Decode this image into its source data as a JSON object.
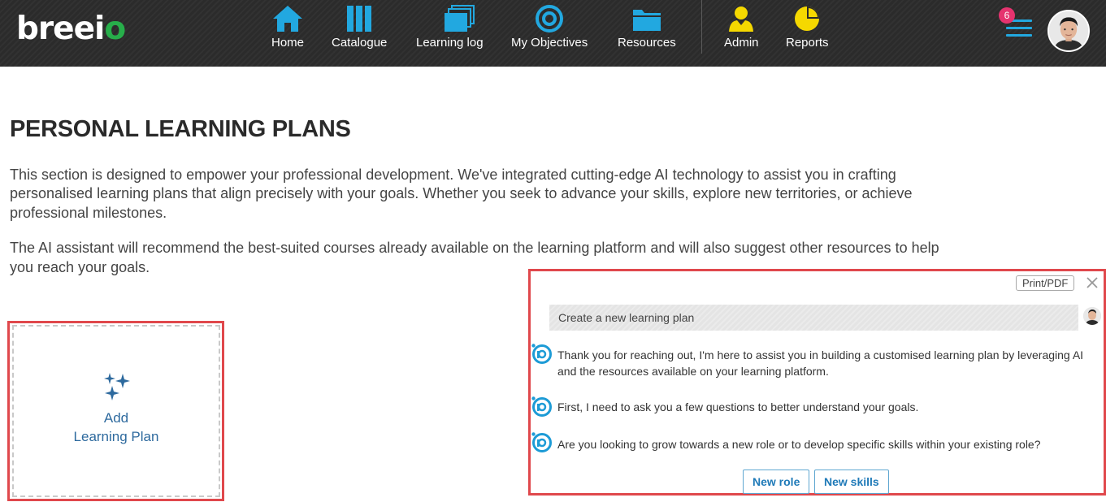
{
  "brand": {
    "logo_text": "breeio",
    "logo_color": "#ffffff",
    "logo_accent": "#27ae4a"
  },
  "nav": {
    "items": [
      {
        "label": "Home",
        "icon": "home-icon"
      },
      {
        "label": "Catalogue",
        "icon": "catalogue-icon"
      },
      {
        "label": "Learning log",
        "icon": "learning-log-icon"
      },
      {
        "label": "My Objectives",
        "icon": "target-icon"
      },
      {
        "label": "Resources",
        "icon": "folder-icon"
      },
      {
        "label": "Admin",
        "icon": "admin-icon"
      },
      {
        "label": "Reports",
        "icon": "pie-chart-icon"
      }
    ],
    "icon_color": "#22a8e0",
    "admin_icon_color": "#f5d800",
    "notifications_count": "6",
    "badge_color": "#e5336f"
  },
  "page": {
    "title": "PERSONAL LEARNING PLANS",
    "intro_p1": "This section is designed to empower your professional development. We've integrated cutting-edge AI technology to assist you in crafting personalised learning plans that align precisely with your goals. Whether you seek to advance your skills, explore new territories, or achieve professional milestones.",
    "intro_p2": "The AI assistant will recommend the best-suited courses already available on the learning platform and will also suggest other resources to help you reach your goals."
  },
  "add_plan": {
    "line1": "Add",
    "line2": "Learning Plan"
  },
  "chat": {
    "print_label": "Print/PDF",
    "user_message": "Create a new learning plan",
    "bot_messages": [
      "Thank you for reaching out, I'm here to assist you in building a customised learning plan by leveraging AI and the resources available on your learning platform.",
      "First, I need to ask you a few questions to better understand your goals.",
      "Are you looking to grow towards a new role or to develop specific skills within your existing role?"
    ],
    "choices": [
      "New role",
      "New skills"
    ]
  }
}
